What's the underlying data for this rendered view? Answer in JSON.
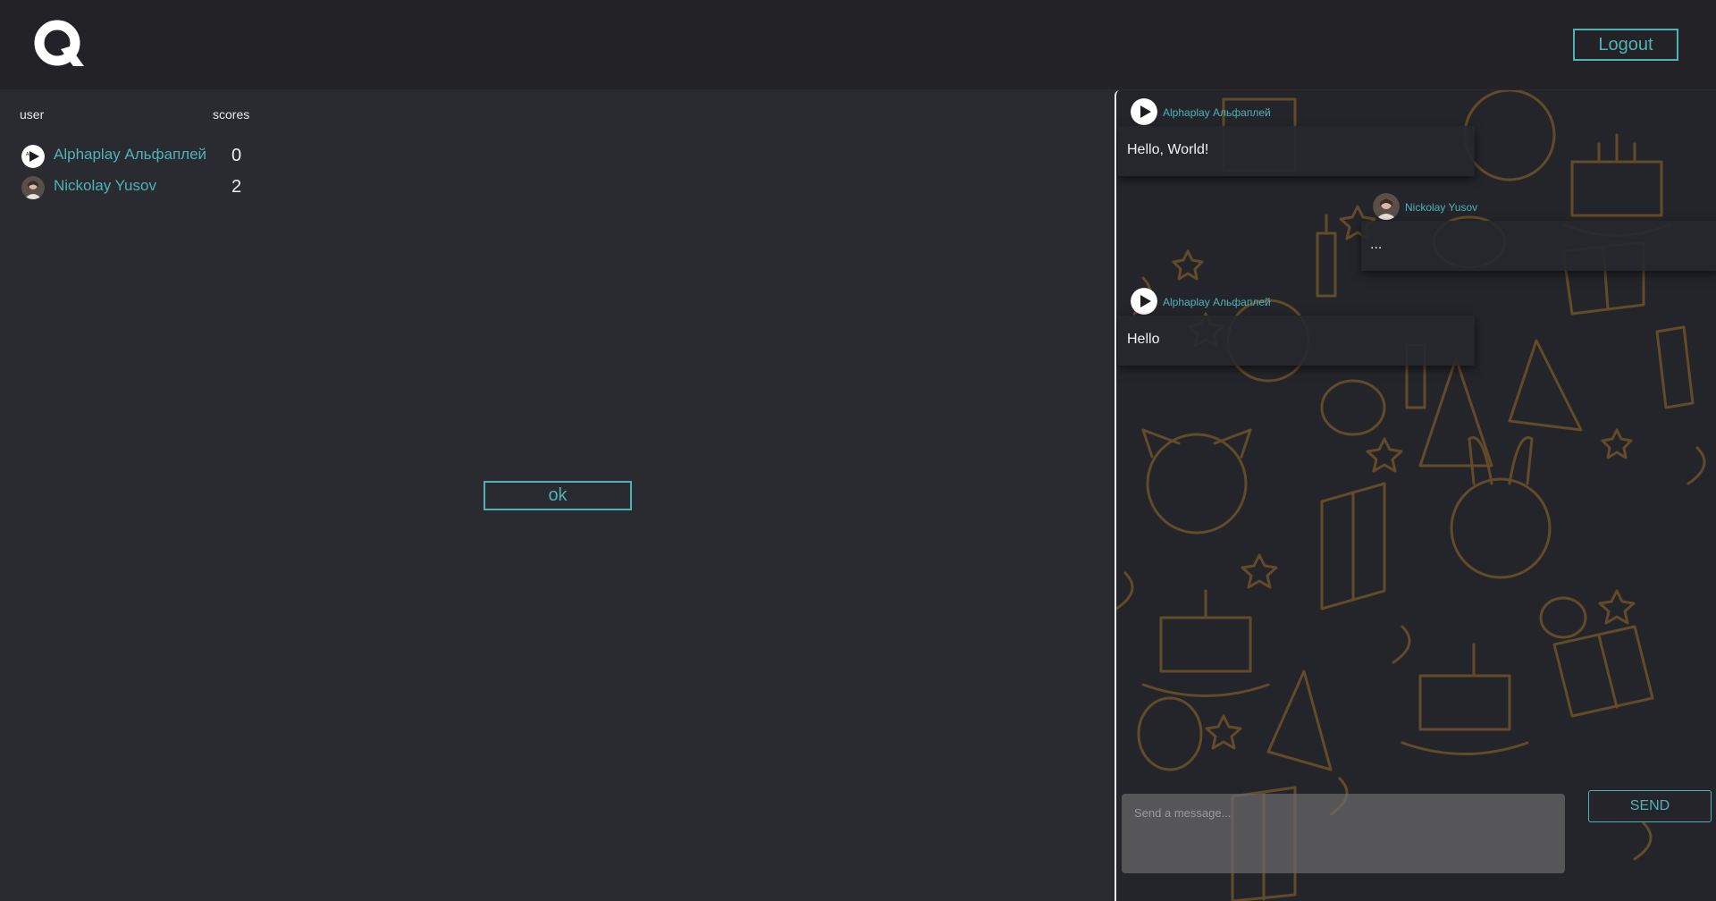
{
  "header": {
    "logo_icon": "q-logo-icon",
    "logout_label": "Logout"
  },
  "scoreboard": {
    "col_user": "user",
    "col_scores": "scores",
    "rows": [
      {
        "name": "Alphaplay Альфаплей",
        "score": "0",
        "avatar": "alphaplay-avatar"
      },
      {
        "name": "Nickolay Yusov",
        "score": "2",
        "avatar": "user-photo-avatar"
      }
    ]
  },
  "main": {
    "ok_label": "ok"
  },
  "chat": {
    "messages": [
      {
        "author": "Alphaplay Альфаплей",
        "text": "Hello, World!",
        "side": "left"
      },
      {
        "author": "Nickolay Yusov",
        "text": "...",
        "side": "right"
      },
      {
        "author": "Alphaplay Альфаплей",
        "text": "Hello",
        "side": "left"
      }
    ],
    "input_placeholder": "Send a message...",
    "send_label": "SEND"
  },
  "colors": {
    "accent": "#4fb3b5",
    "header_bg": "#232327",
    "page_bg": "#2a2b31",
    "chat_bg": "#24252a",
    "doodle": "#7a5a2c"
  }
}
